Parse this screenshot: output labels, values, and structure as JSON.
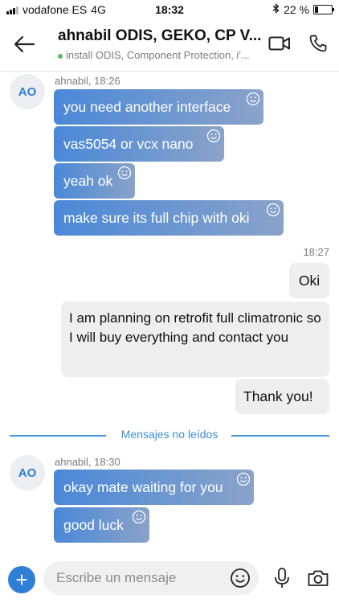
{
  "status_bar": {
    "carrier": "vodafone ES",
    "network": "4G",
    "time": "18:32",
    "battery_percent": "22 %",
    "battery_level": 0.22
  },
  "header": {
    "title": "ahnabil ODIS, GEKO, CP V...",
    "subtitle": "install ODIS, Component Protection, i'...",
    "online_color": "#5cb85c"
  },
  "messages_group_1": {
    "avatar": "AO",
    "sender_time": "ahnabil, 18:26",
    "items": [
      "you need another interface",
      "vas5054 or vcx nano",
      "yeah ok",
      "make sure its full chip with oki"
    ]
  },
  "outgoing": {
    "time": "18:27",
    "items": [
      "Oki",
      "I am planning on retrofit full climatronic so I will buy everything and contact you",
      "Thank you!"
    ]
  },
  "unread_divider": "Mensajes no leídos",
  "messages_group_2": {
    "avatar": "AO",
    "sender_time": "ahnabil, 18:30",
    "items": [
      "okay mate waiting for you",
      "good luck"
    ]
  },
  "composer": {
    "placeholder": "Escribe un mensaje"
  },
  "colors": {
    "accent": "#2f7fd6",
    "bubble_in_start": "#4a88d8",
    "bubble_in_end": "#8aa3c9",
    "bubble_out": "#eeeeef"
  }
}
